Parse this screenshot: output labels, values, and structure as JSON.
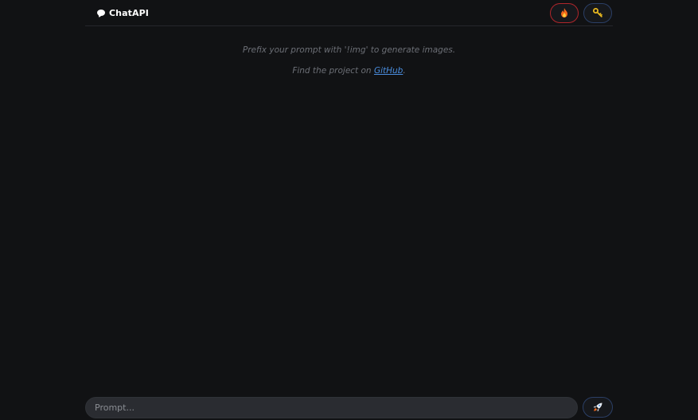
{
  "header": {
    "title": "ChatAPI",
    "brand_icon": "speech-bubble-icon",
    "buttons": [
      {
        "icon": "fire-icon",
        "accent": "#b0262b"
      },
      {
        "icon": "key-icon",
        "accent": "#2b3f66"
      }
    ]
  },
  "intro": {
    "line1": "Prefix your prompt with '!img' to generate images.",
    "line2_prefix": "Find the project on ",
    "line2_link": "GitHub",
    "line2_suffix": "."
  },
  "composer": {
    "placeholder": "Prompt...",
    "send_icon": "rocket-icon"
  },
  "colors": {
    "background": "#111214",
    "link": "#4a8dde",
    "muted_text": "#6c6f76"
  }
}
